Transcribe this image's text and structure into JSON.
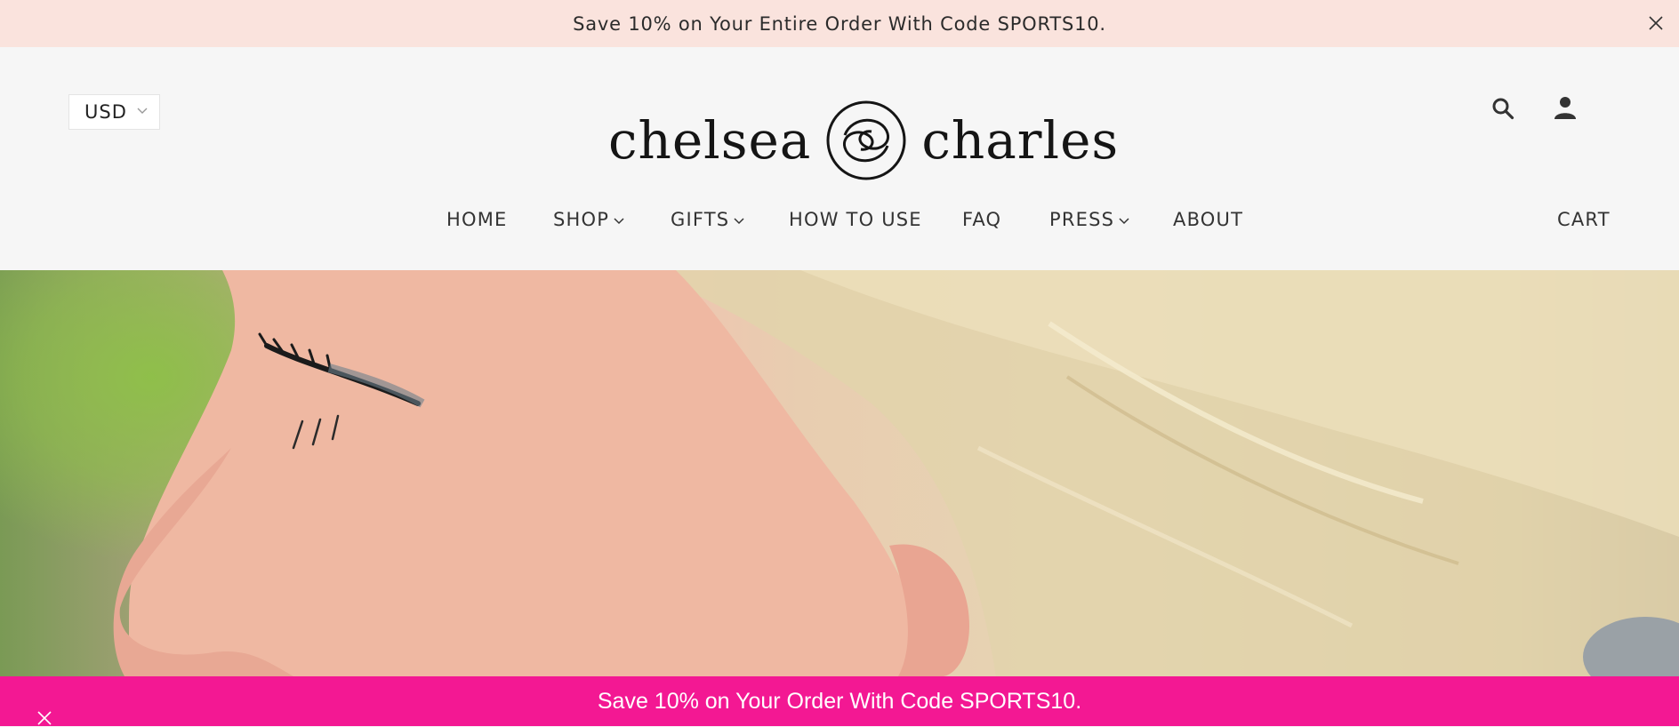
{
  "announcement": {
    "text": "Save 10% on Your Entire Order With Code SPORTS10.",
    "close_icon": "close-icon"
  },
  "header": {
    "currency": {
      "selected": "USD",
      "icon": "chevron-down-icon"
    },
    "logo": {
      "word_left": "chelsea",
      "word_right": "charles",
      "mark_icon": "logo-monogram-icon"
    },
    "icons": {
      "search": "search-icon",
      "account": "user-icon"
    }
  },
  "nav": {
    "items": [
      {
        "label": "HOME",
        "has_dropdown": false
      },
      {
        "label": "SHOP",
        "has_dropdown": true
      },
      {
        "label": "GIFTS",
        "has_dropdown": true
      },
      {
        "label": "HOW TO USE",
        "has_dropdown": false
      },
      {
        "label": "FAQ",
        "has_dropdown": false
      },
      {
        "label": "PRESS",
        "has_dropdown": true
      },
      {
        "label": "ABOUT",
        "has_dropdown": false
      }
    ],
    "cart_label": "CART"
  },
  "hero": {
    "description_icon": "hero-image"
  },
  "promo_bar": {
    "text": "Save 10% on Your Order With Code SPORTS10.",
    "close_icon": "close-icon"
  },
  "colors": {
    "announcement_bg": "#fae3dd",
    "header_bg": "#f6f6f6",
    "promo_bg": "#f31893",
    "text": "#333333"
  }
}
